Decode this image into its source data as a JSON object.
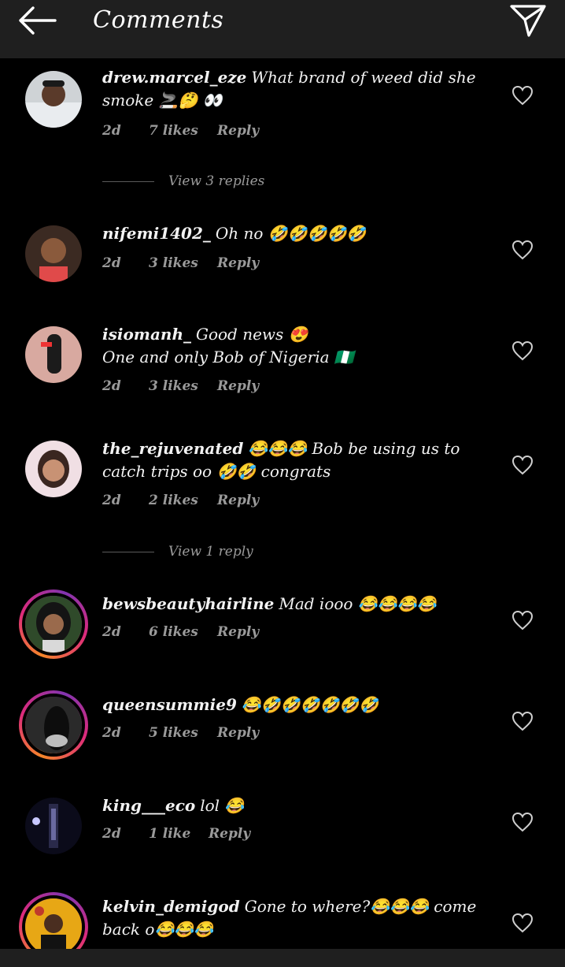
{
  "header": {
    "title": "Comments"
  },
  "comments": [
    {
      "username": "drew.marcel_eze",
      "text": "What brand of weed did she smoke 🚬🤔 👀",
      "age": "2d",
      "likes": "7 likes",
      "reply": "Reply"
    },
    {
      "username": "nifemi1402_",
      "text": "Oh no 🤣🤣🤣🤣🤣",
      "age": "2d",
      "likes": "3 likes",
      "reply": "Reply"
    },
    {
      "username": "isiomanh_",
      "text": "Good news 😍",
      "text2": "One and only Bob of Nigeria 🇳🇬",
      "age": "2d",
      "likes": "3 likes",
      "reply": "Reply"
    },
    {
      "username": "the_rejuvenated",
      "text": "😂😂😂 Bob be using us to catch trips oo 🤣🤣 congrats",
      "age": "2d",
      "likes": "2 likes",
      "reply": "Reply"
    },
    {
      "username": "bewsbeautyhairline",
      "text": "Mad iooo 😂😂😂😂",
      "age": "2d",
      "likes": "6 likes",
      "reply": "Reply"
    },
    {
      "username": "queensummie9",
      "text": "😂🤣🤣🤣🤣🤣🤣",
      "age": "2d",
      "likes": "5 likes",
      "reply": "Reply"
    },
    {
      "username": "king___eco",
      "text": "lol 😂",
      "age": "2d",
      "likes": "1 like",
      "reply": "Reply"
    },
    {
      "username": "kelvin_demigod",
      "text": "Gone to where?😂😂😂 come back o😂😂😂",
      "age": "",
      "likes": "",
      "reply": ""
    }
  ],
  "view_replies": [
    "View 3 replies",
    "View 1 reply"
  ],
  "colors": {
    "background": "#000000",
    "topbar": "#1f1f1f",
    "meta_text": "#9a9a9a",
    "story_ring_start": "#f58529",
    "story_ring_end": "#dd2a7b"
  },
  "icons": {
    "back": "back-arrow-icon",
    "send": "send-icon",
    "like": "heart-icon"
  }
}
